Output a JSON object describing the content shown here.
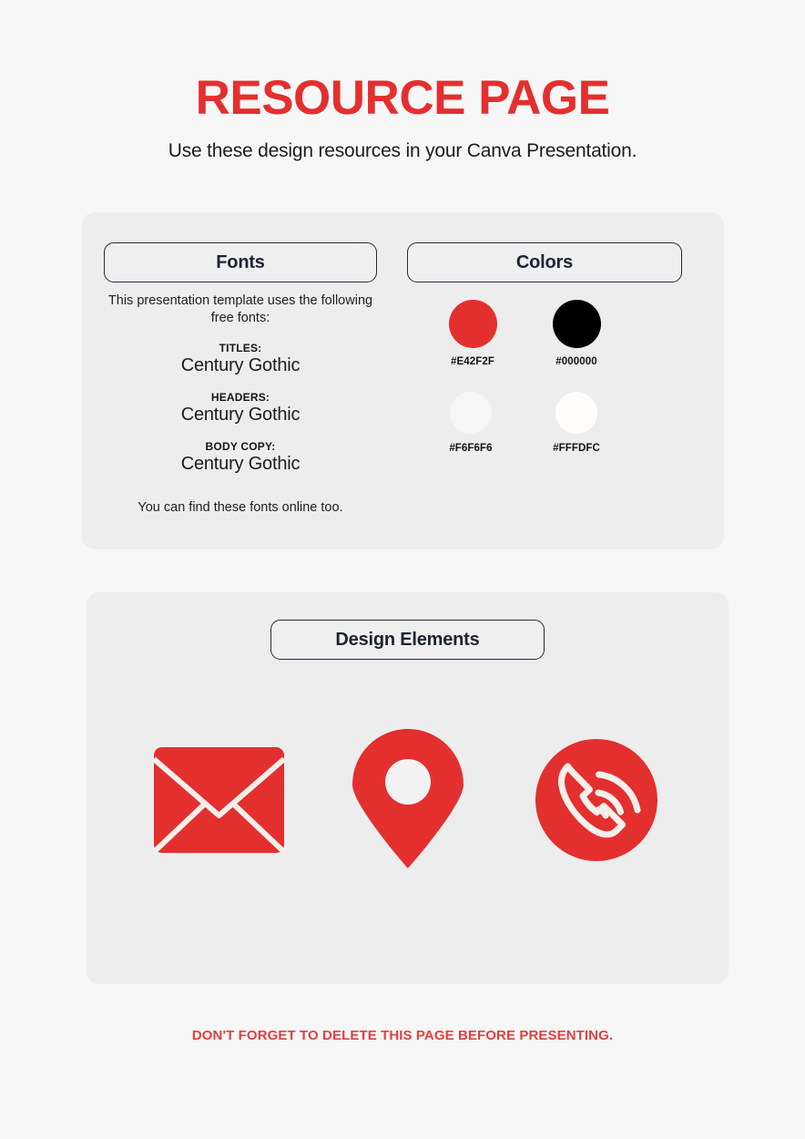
{
  "header": {
    "title": "RESOURCE PAGE",
    "subtitle": "Use these design resources in your Canva Presentation."
  },
  "fonts_card": {
    "pill_label": "Fonts",
    "intro": "This presentation template uses the following free fonts:",
    "groups": [
      {
        "role": "TITLES:",
        "font": "Century Gothic"
      },
      {
        "role": "HEADERS:",
        "font": "Century Gothic"
      },
      {
        "role": "BODY COPY:",
        "font": "Century Gothic"
      }
    ],
    "footnote": "You can find these fonts online too."
  },
  "colors_card": {
    "pill_label": "Colors",
    "swatches": [
      {
        "hex_label": "#E42F2F",
        "color": "#E42F2F"
      },
      {
        "hex_label": "#000000",
        "color": "#000000"
      },
      {
        "hex_label": "#F6F6F6",
        "color": "#F6F6F6"
      },
      {
        "hex_label": "#FFFDFC",
        "color": "#FFFDFC"
      }
    ]
  },
  "elements_card": {
    "pill_label": "Design Elements",
    "accent_color": "#E42F2F",
    "icons": [
      {
        "name": "envelope-icon",
        "label": "Envelope"
      },
      {
        "name": "location-pin-icon",
        "label": "Location Pin"
      },
      {
        "name": "phone-call-icon",
        "label": "Phone Call"
      }
    ]
  },
  "footer": {
    "note": "DON'T FORGET TO DELETE THIS PAGE BEFORE PRESENTING."
  }
}
